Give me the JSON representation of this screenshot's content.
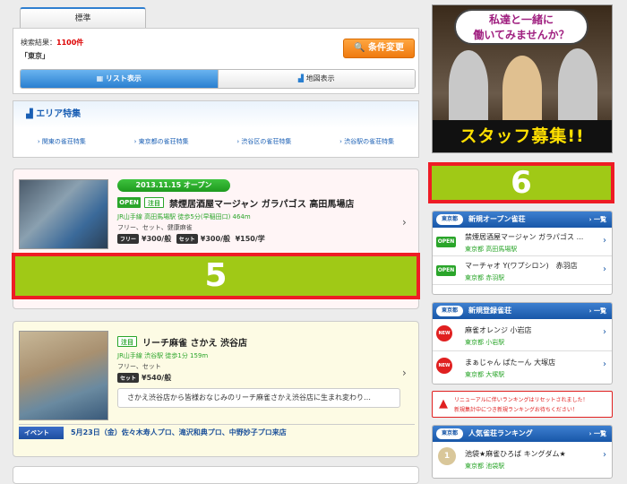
{
  "tab": {
    "label": "標準"
  },
  "search": {
    "result_label": "検索結果：",
    "result_count": "1100件",
    "area": "「東京」",
    "change_button": "条件変更"
  },
  "views": {
    "list": "リスト表示",
    "map": "地図表示"
  },
  "area_feature": {
    "title": "エリア特集",
    "links": [
      "関東の雀荘特集",
      "東京都の雀荘特集",
      "渋谷区の雀荘特集",
      "渋谷駅の雀荘特集"
    ]
  },
  "listing1": {
    "date_badge": "2013.11.15 オープン",
    "open_badge": "OPEN",
    "featured_badge": "注目",
    "name": "禁煙居酒屋マージャン ガラパゴス 高田馬場店",
    "access": "JR山手線 高田馬場駅 徒歩5分(早稲田口) 464m",
    "types": "フリー、セット、健康麻雀",
    "prices": [
      {
        "tag": "フリー",
        "value": "¥300/般"
      },
      {
        "tag": "セット",
        "value": "¥300/般"
      },
      {
        "tag": "",
        "value": "¥150/学"
      }
    ],
    "placeholder": "5"
  },
  "listing2": {
    "featured_badge": "注目",
    "name": "リーチ麻雀 さかえ 渋谷店",
    "access": "JR山手線 渋谷駅 徒歩1分 159m",
    "types": "フリー、セット",
    "prices": [
      {
        "tag": "セット",
        "value": "¥540/般"
      }
    ],
    "comment": "さかえ渋谷店から皆様おなじみのリーチ麻雀さかえ渋谷店に生まれ変わり…",
    "event_tag": "イベント",
    "event_text": "5月23日（金）佐々木寿人プロ、滝沢和典プロ、中野妙子プロ来店"
  },
  "ad": {
    "bubble_line1": "私達と一緒に",
    "bubble_line2": "働いてみませんか？",
    "staff_text": "スタッフ募集!!"
  },
  "placeholder6": "6",
  "new_open": {
    "region": "東京都",
    "title": "新規オープン雀荘",
    "more": "一覧",
    "items": [
      {
        "badge": "OPEN",
        "name": "禁煙居酒屋マージャン ガラパゴス ...",
        "loc": "東京都 高田馬場駅"
      },
      {
        "badge": "OPEN",
        "name": "マーチャオ Y(ワプシロン)　赤羽店",
        "loc": "東京都 赤羽駅"
      }
    ]
  },
  "new_reg": {
    "region": "東京都",
    "title": "新規登録雀荘",
    "more": "一覧",
    "items": [
      {
        "badge": "NEW",
        "name": "麻雀オレンジ 小岩店",
        "loc": "東京都 小岩駅"
      },
      {
        "badge": "NEW",
        "name": "まぁじゃん ぱたーん 大塚店",
        "loc": "東京都 大塚駅"
      }
    ]
  },
  "notice": {
    "line1": "リニューアルに伴いランキングはリセットされました！",
    "line2": "新規集計中につき新規ランキングお待ちください！"
  },
  "ranking": {
    "region": "東京都",
    "title": "人気雀荘ランキング",
    "more": "一覧",
    "items": [
      {
        "rank": "1",
        "name": "池袋★麻雀ひろば キングダム★",
        "loc": "東京都 池袋駅"
      }
    ]
  },
  "colors": {
    "accent": "#1857a8",
    "placeholder_green": "#a0c916",
    "placeholder_border": "#ee1c25",
    "cta_orange": "#ef7a0f"
  }
}
